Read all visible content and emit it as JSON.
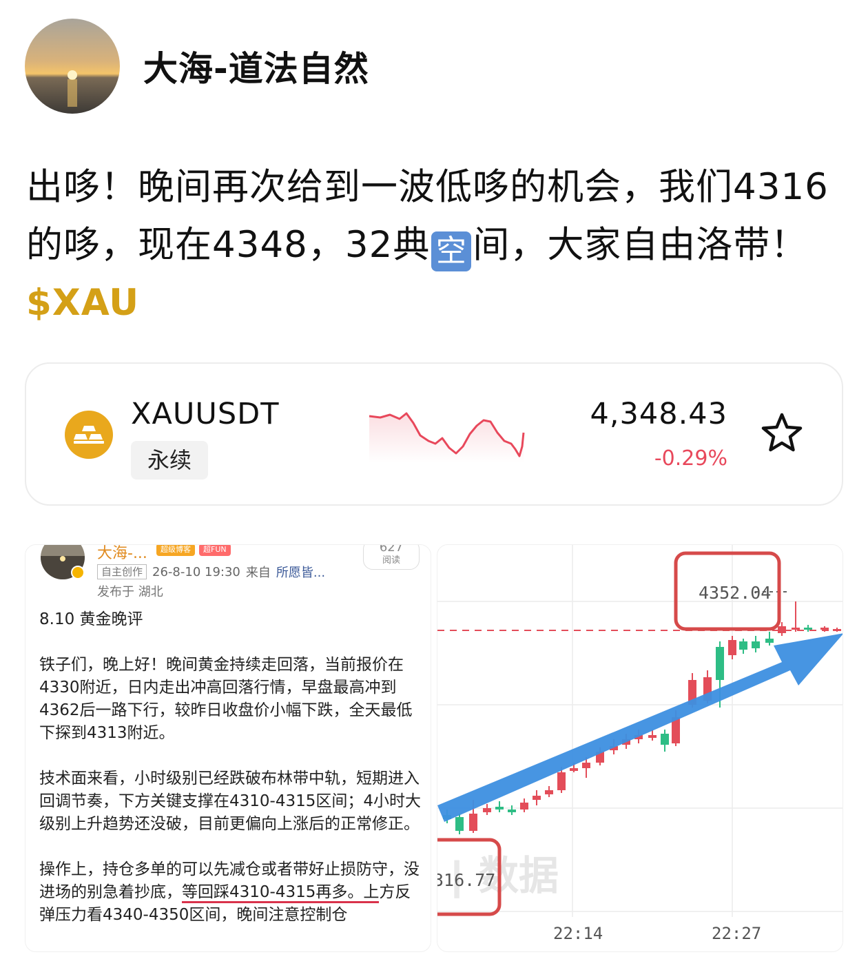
{
  "author": {
    "name": "大海-道法自然",
    "avatar_icon": "sunset-avatar"
  },
  "post": {
    "text_part1": "出哆！晚间再次给到一波低哆的机会，我们4316的哆，现在4348，32典",
    "emoji": "空",
    "text_part2": "间，大家自由洛带！",
    "ticker": "$XAU"
  },
  "ticker_card": {
    "symbol": "XAUUSDT",
    "contract_type": "永续",
    "price": "4,348.43",
    "change": "-0.29%",
    "change_color": "#e8485b",
    "icon": "gold-bars-icon",
    "favorite_icon": "star-icon"
  },
  "article_image": {
    "author": "大海-...",
    "badges": [
      "超级博客",
      "超FUN"
    ],
    "views_count": "627",
    "views_label": "阅读",
    "tag": "自主创作",
    "datetime": "26-8-10 19:30",
    "from_label": "来自",
    "from_value": "所愿皆...",
    "location": "发布于 湖北",
    "title": "8.10 黄金晚评",
    "para1": "铁子们，晚上好！晚间黄金持续走回落，当前报价在4330附近，日内走出冲高回落行情，早盘最高冲到4362后一路下行，较昨日收盘价小幅下跌，全天最低下探到4313附近。",
    "para2": "技术面来看，小时级别已经跌破布林带中轨，短期进入回调节奏，下方关键支撑在4310-4315区间；4小时大级别上升趋势还没破，目前更偏向上涨后的正常修正。",
    "para3_a": "操作上，持仓多单的可以先减仓或者带好止损防守，没进场的别急着抄底，",
    "para3_hl": "等回踩4310-4315再多。上",
    "para3_b": "方反弹压力看4340-4350区间，晚间注意控制仓"
  },
  "chart_image": {
    "high_label": "4352.04",
    "low_label": "316.77",
    "watermark": "数据",
    "time_labels": [
      "22:14",
      "22:27"
    ],
    "up_color": "#e34d59",
    "down_color": "#2ebd85",
    "arrow_color": "#3d8fe0"
  }
}
